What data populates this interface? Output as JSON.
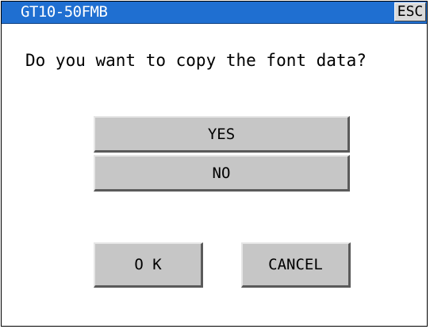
{
  "window": {
    "title": "GT10-50FMB",
    "esc_label": "ESC"
  },
  "dialog": {
    "prompt": "Do you want to copy the font data?",
    "yes_label": "YES",
    "no_label": "NO",
    "ok_label": "O K",
    "cancel_label": "CANCEL"
  },
  "colors": {
    "title_bar": "#1f6fd1",
    "button_face": "#c6c6c6",
    "background": "#ffffff"
  }
}
